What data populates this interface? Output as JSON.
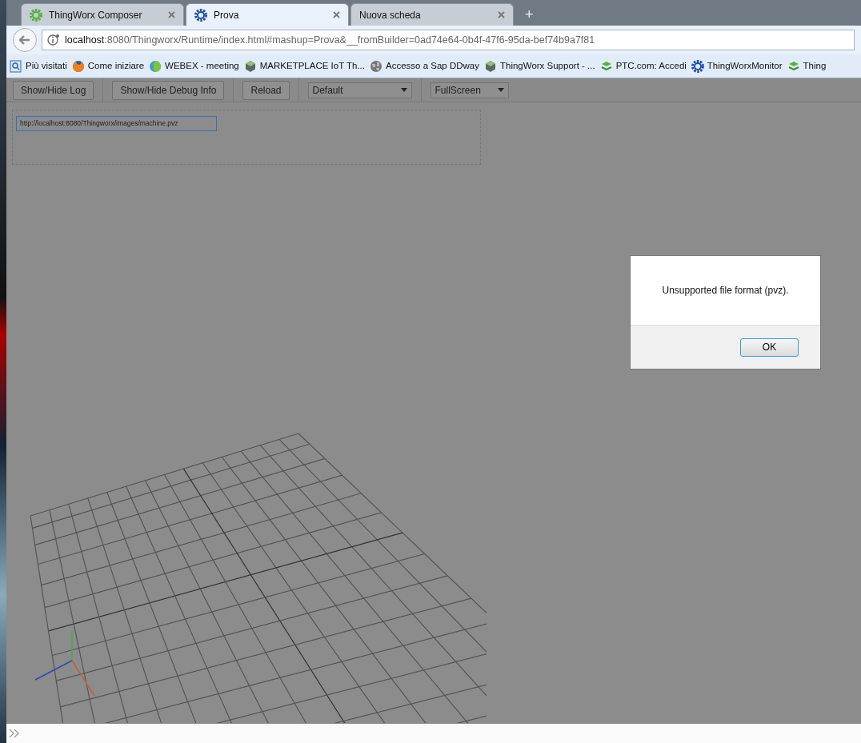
{
  "tabs": [
    {
      "label": "ThingWorx Composer",
      "selected": false
    },
    {
      "label": "Prova",
      "selected": true
    },
    {
      "label": "Nuova scheda",
      "selected": false
    }
  ],
  "new_tab": "+",
  "address": {
    "host": "localhost",
    "rest": ":8080/Thingworx/Runtime/index.html#mashup=Prova&__fromBuilder=0ad74e64-0b4f-47f6-95da-bef74b9a7f81"
  },
  "bookmarks": [
    "Più visitati",
    "Come iniziare",
    "WEBEX - meeting",
    "MARKETPLACE IoT Th...",
    "Accesso a Sap DDway",
    "ThingWorx Support - ...",
    "PTC.com: Accedi",
    "ThingWorxMonitor",
    "Thing"
  ],
  "toolbar": {
    "buttons": [
      "Show/Hide Log",
      "Show/Hide Debug Info",
      "Reload"
    ],
    "selects": [
      "Default",
      "FullScreen"
    ]
  },
  "url_field": {
    "value": "http://localhost:8080/Thingworx/images/machine.pvz"
  },
  "dialog": {
    "message": "Unsupported file format (pvz).",
    "button": "OK"
  }
}
